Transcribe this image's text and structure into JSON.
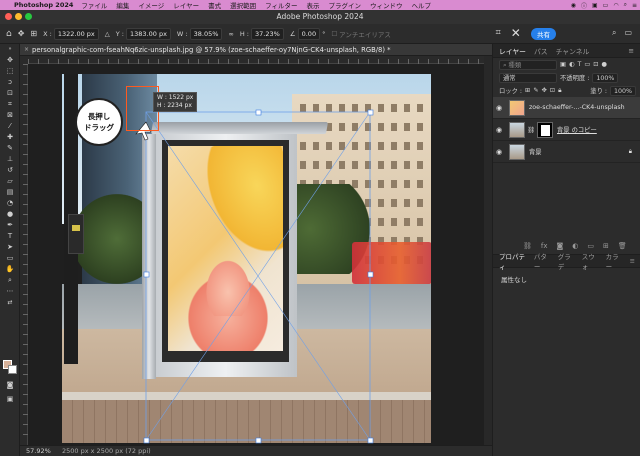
{
  "menubar": {
    "app_name": "Photoshop 2024",
    "items": [
      "ファイル",
      "編集",
      "イメージ",
      "レイヤー",
      "書式",
      "選択範囲",
      "フィルター",
      "表示",
      "プラグイン",
      "ウィンドウ",
      "ヘルプ"
    ]
  },
  "window": {
    "title": "Adobe Photoshop 2024"
  },
  "options": {
    "x_label": "X :",
    "x_value": "1322.00 px",
    "y_label": "Y :",
    "y_value": "1383.00 px",
    "w_label": "W :",
    "w_value": "38.05%",
    "h_label": "H :",
    "h_value": "37.23%",
    "angle_value": "0.00",
    "angle_unit": "°",
    "antialias_label": "アンチエイリアス",
    "share_label": "共有"
  },
  "document": {
    "tab_title": "personalgraphic-com-fseahNq6zic-unsplash.jpg @ 57.9% (zoe-schaeffer-oy7NjnG-CK4-unsplash, RGB/8) *",
    "close_glyph": "×"
  },
  "callout": {
    "line1": "長押し",
    "line2": "ドラッグ"
  },
  "dimension_tooltip": {
    "w": "W : 1522 px",
    "h": "H : 2234 px"
  },
  "status": {
    "zoom": "57.92%",
    "doc_info": "2500 px x 2500 px (72 ppi)"
  },
  "panels": {
    "tabs": [
      "レイヤー",
      "パス",
      "チャンネル"
    ],
    "search_placeholder": "種類",
    "blend_mode": "通常",
    "opacity_label": "不透明度 :",
    "opacity_value": "100%",
    "lock_label": "ロック :",
    "fill_label": "塗り :",
    "fill_value": "100%",
    "layers": [
      {
        "name": "zoe-schaeffer-...-CK4-unsplash",
        "selected": true
      },
      {
        "name": "背景 のコピー",
        "selected": false
      },
      {
        "name": "背景",
        "selected": false
      }
    ],
    "props_tabs": [
      "プロパティ",
      "パター",
      "グラデ",
      "スウォ",
      "カラー"
    ],
    "props_body": "属性なし"
  },
  "colors": {
    "menubar": "#d98bd0",
    "accent": "#2680eb",
    "highlight": "#ff5a1f",
    "foreground_swatch": "#d8b29a",
    "background_swatch": "#ffffff"
  }
}
